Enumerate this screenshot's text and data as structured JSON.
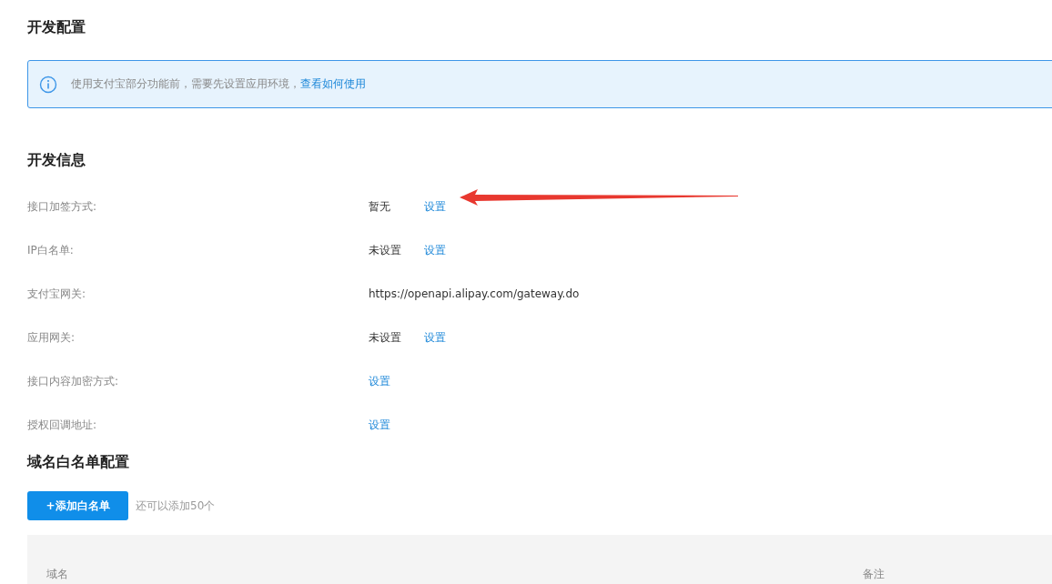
{
  "page_title": "开发配置",
  "notice": {
    "text": "使用支付宝部分功能前，需要先设置应用环境，",
    "link": "查看如何使用"
  },
  "dev_info": {
    "title": "开发信息",
    "rows": [
      {
        "label": "接口加签方式:",
        "value": "暂无",
        "link": "设置"
      },
      {
        "label": "IP白名单:",
        "value": "未设置",
        "link": "设置"
      },
      {
        "label": "支付宝网关:",
        "value": "https://openapi.alipay.com/gateway.do"
      },
      {
        "label": "应用网关:",
        "value": "未设置",
        "link": "设置"
      },
      {
        "label": "接口内容加密方式:",
        "link": "设置"
      },
      {
        "label": "授权回调地址:",
        "link": "设置"
      }
    ]
  },
  "whitelist": {
    "title": "域名白名单配置",
    "add_button": "+添加白名单",
    "hint": "还可以添加50个",
    "table": {
      "columns": [
        "域名",
        "备注"
      ]
    }
  }
}
